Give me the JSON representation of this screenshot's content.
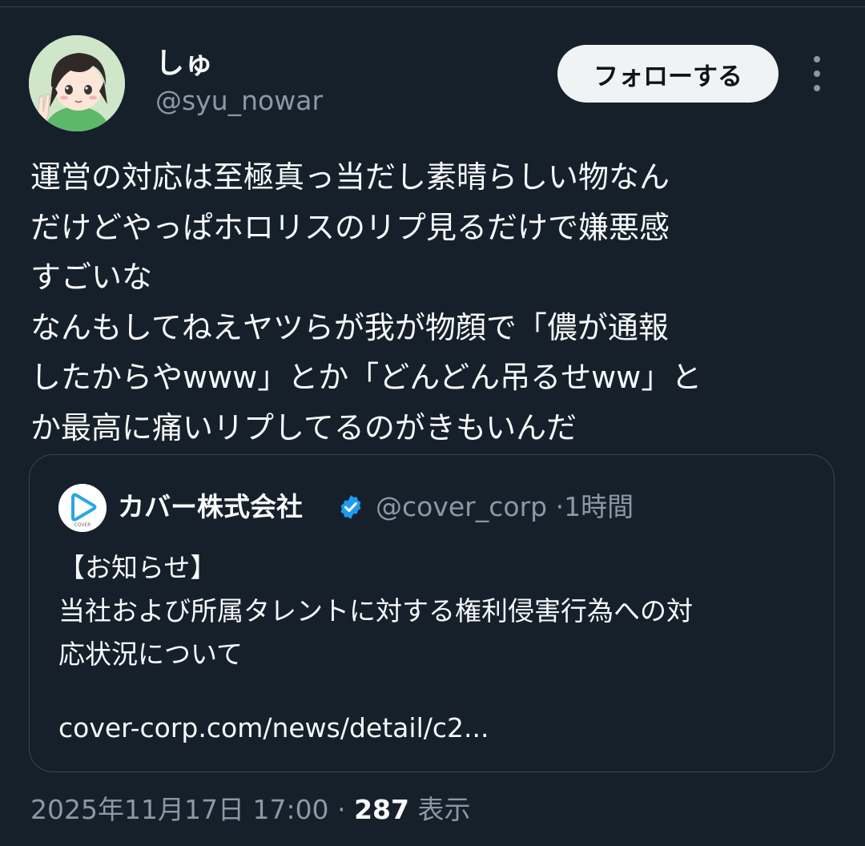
{
  "author": {
    "display_name": "しゅ",
    "handle": "@syu_nowar"
  },
  "follow_button": {
    "label": "フォローする"
  },
  "more_menu_icon": "more-vertical-icon",
  "tweet": {
    "lines": [
      "運営の対応は至極真っ当だし素晴らしい物なん",
      "だけどやっぱホロリスのリプ見るだけで嫌悪感",
      "すごいな",
      "なんもしてねえヤツらが我が物顔で「儂が通報",
      "したからやwww」とか「どんどん吊るせww」と",
      "か最高に痛いリプしてるのがきもいんだ"
    ]
  },
  "quote": {
    "display_name": "カバー株式会社",
    "verified": true,
    "handle": "@cover_corp",
    "separator": "·",
    "time": "1時間",
    "avatar_text": "COVER",
    "lines": [
      "【お知らせ】",
      "当社および所属タレントに対する権利侵害行為への対",
      "応状況について"
    ],
    "link": "cover-corp.com/news/detail/c2..."
  },
  "footer": {
    "timestamp": "2025年11月17日 17:00",
    "separator": "·",
    "view_count": "287",
    "view_label": "表示"
  },
  "colors": {
    "background": "#15202b",
    "text_primary": "#f7f9f9",
    "text_secondary": "#8b98a5",
    "border": "#38444d",
    "verified": "#1d9bf0",
    "follow_button_bg": "#eff3f4"
  }
}
